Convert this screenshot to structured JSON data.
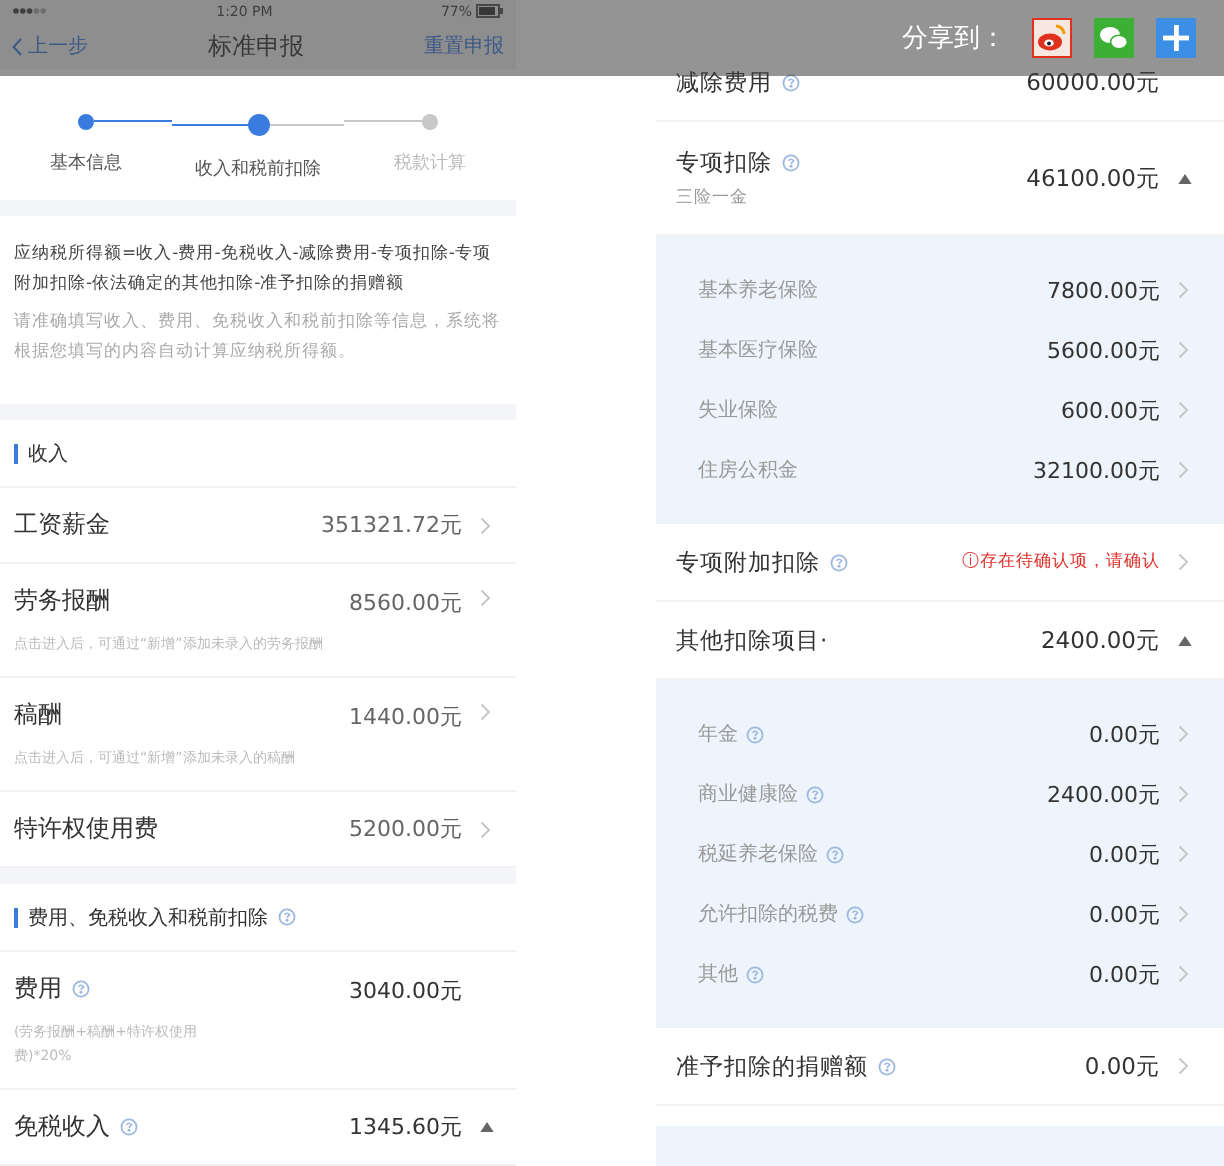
{
  "left_screen": {
    "status_bar": {
      "time": "1:20 PM",
      "battery": "77%"
    },
    "nav": {
      "back": "上一步",
      "title": "标准申报",
      "action": "重置申报"
    },
    "steps": [
      {
        "label": "基本信息",
        "completed": true,
        "selected": false
      },
      {
        "label": "收入和税前扣除",
        "completed": false,
        "selected": true
      },
      {
        "label": "税款计算",
        "completed": false,
        "selected": false
      }
    ],
    "formula": "应纳税所得额=收入-费用-免税收入-减除费用-专项扣除-专项附加扣除-依法确定的其他扣除-准予扣除的捐赠额",
    "hint": "请准确填写收入、费用、免税收入和税前扣除等信息，系统将根据您填写的内容自动计算应纳税所得额。",
    "sections": [
      {
        "title": "收入",
        "info": false,
        "rows": [
          {
            "kind": "link",
            "label": "工资薪金",
            "info": false,
            "value": "351321.72元"
          },
          {
            "kind": "link",
            "label": "劳务报酬",
            "info": false,
            "value": "8560.00元",
            "note": "点击进入后，可通过“新增”添加未录入的劳务报酬"
          },
          {
            "kind": "link",
            "label": "稿酬",
            "info": false,
            "value": "1440.00元",
            "note": "点击进入后，可通过“新增”添加未录入的稿酬"
          },
          {
            "kind": "link",
            "label": "特许权使用费",
            "info": false,
            "value": "5200.00元"
          }
        ]
      },
      {
        "title": "费用、免税收入和税前扣除",
        "info": true,
        "rows": [
          {
            "kind": "plain",
            "label": "费用",
            "info": true,
            "value": "3040.00元",
            "note": "(劳务报酬+稿酬+特许权使用费)*20%"
          },
          {
            "kind": "group",
            "label": "免税收入",
            "info": true,
            "value": "1345.60元",
            "expanded": true
          }
        ]
      }
    ]
  },
  "right_screen": {
    "rows": [
      {
        "kind": "plain",
        "label": "减除费用",
        "info": true,
        "value": "60000.00元"
      },
      {
        "kind": "group",
        "label": "专项扣除",
        "info": true,
        "note": "三险一金",
        "value": "46100.00元",
        "expanded": true,
        "children": [
          {
            "label": "基本养老保险",
            "info": false,
            "value": "7800.00元"
          },
          {
            "label": "基本医疗保险",
            "info": false,
            "value": "5600.00元"
          },
          {
            "label": "失业保险",
            "info": false,
            "value": "600.00元"
          },
          {
            "label": "住房公积金",
            "info": false,
            "value": "32100.00元"
          }
        ]
      },
      {
        "kind": "link",
        "label": "专项附加扣除",
        "info": true,
        "warning": "ⓘ存在待确认项，请确认"
      },
      {
        "kind": "group",
        "label": "其他扣除项目·",
        "info": false,
        "value": "2400.00元",
        "expanded": true,
        "children": [
          {
            "label": "年金",
            "info": true,
            "value": "0.00元"
          },
          {
            "label": "商业健康险",
            "info": true,
            "value": "2400.00元"
          },
          {
            "label": "税延养老保险",
            "info": true,
            "value": "0.00元"
          },
          {
            "label": "允许扣除的税费",
            "info": true,
            "value": "0.00元"
          },
          {
            "label": "其他",
            "info": true,
            "value": "0.00元"
          }
        ]
      },
      {
        "kind": "link",
        "label": "准予扣除的捐赠额",
        "info": true,
        "value": "0.00元"
      }
    ]
  },
  "share_bar": {
    "label": "分享到：",
    "targets": [
      {
        "kind": "weibo"
      },
      {
        "kind": "wechat"
      },
      {
        "kind": "more"
      }
    ]
  }
}
